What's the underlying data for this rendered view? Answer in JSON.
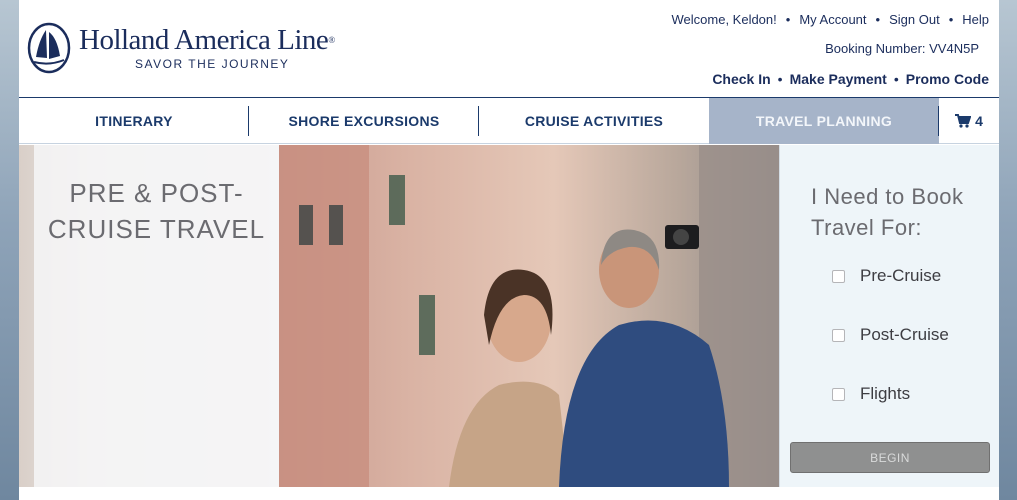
{
  "brand": {
    "name": "Holland America Line",
    "registered": "®",
    "tagline": "SAVOR THE JOURNEY"
  },
  "header": {
    "welcome": "Welcome, Keldon!",
    "links": [
      "My Account",
      "Sign Out",
      "Help"
    ],
    "booking": "Booking Number: VV4N5P",
    "actions": [
      "Check In",
      "Make Payment",
      "Promo Code"
    ]
  },
  "nav": {
    "items": [
      "ITINERARY",
      "SHORE EXCURSIONS",
      "CRUISE ACTIVITIES",
      "TRAVEL PLANNING"
    ],
    "active": "TRAVEL PLANNING",
    "cart_count": "4"
  },
  "hero": {
    "title_line1": "PRE & POST-",
    "title_line2": "CRUISE TRAVEL"
  },
  "booking_panel": {
    "title_line1": "I Need to Book",
    "title_line2": "Travel For:",
    "options": [
      "Pre-Cruise",
      "Post-Cruise",
      "Flights"
    ],
    "button": "BEGIN"
  },
  "colors": {
    "brand_navy": "#1b2d5c",
    "nav_active": "#a6b4c9",
    "panel_bg": "#eef5f9",
    "button_bg": "#8f9090"
  },
  "icons": {
    "logo": "ship-sail-emblem",
    "cart": "shopping-cart-icon"
  }
}
